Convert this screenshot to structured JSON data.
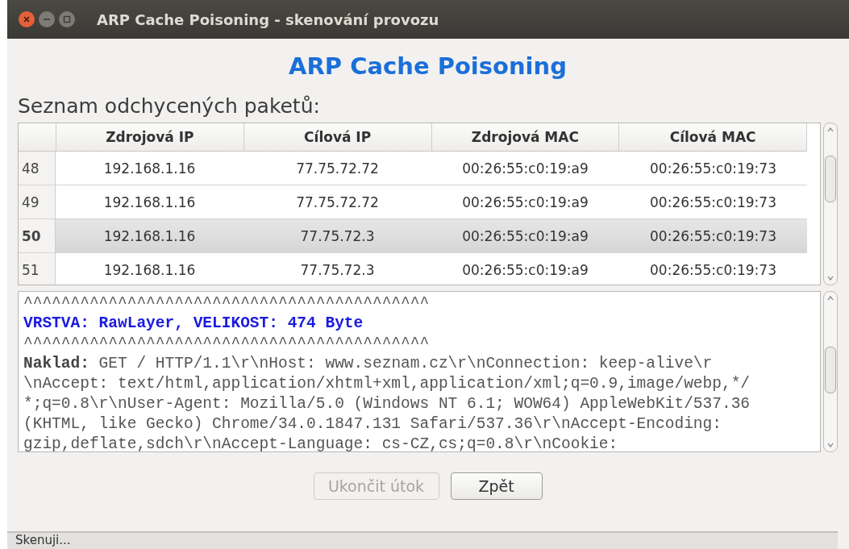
{
  "window": {
    "title": "ARP Cache Poisoning - skenování provozu"
  },
  "heading": "ARP Cache Poisoning",
  "list_label": "Seznam odchycených paketů:",
  "table": {
    "columns": [
      "Zdrojová IP",
      "Cílová IP",
      "Zdrojová MAC",
      "Cílová MAC"
    ],
    "rows": [
      {
        "index": "48",
        "cells": [
          "192.168.1.16",
          "77.75.72.72",
          "00:26:55:c0:19:a9",
          "00:26:55:c0:19:73"
        ],
        "selected": false
      },
      {
        "index": "49",
        "cells": [
          "192.168.1.16",
          "77.75.72.72",
          "00:26:55:c0:19:a9",
          "00:26:55:c0:19:73"
        ],
        "selected": false
      },
      {
        "index": "50",
        "cells": [
          "192.168.1.16",
          "77.75.72.3",
          "00:26:55:c0:19:a9",
          "00:26:55:c0:19:73"
        ],
        "selected": true
      },
      {
        "index": "51",
        "cells": [
          "192.168.1.16",
          "77.75.72.3",
          "00:26:55:c0:19:a9",
          "00:26:55:c0:19:73"
        ],
        "selected": false
      }
    ]
  },
  "detail": {
    "lines": [
      {
        "kind": "rule",
        "text": "^^^^^^^^^^^^^^^^^^^^^^^^^^^^^^^^^^^^^^^^^^^"
      },
      {
        "kind": "layer",
        "text": "VRSTVA: RawLayer, VELIKOST: 474 Byte"
      },
      {
        "kind": "rule",
        "text": "^^^^^^^^^^^^^^^^^^^^^^^^^^^^^^^^^^^^^^^^^^^"
      },
      {
        "kind": "payload",
        "text": "**Naklad:** GET / HTTP/1.1\\r\\nHost: www.seznam.cz\\r\\nConnection: keep-alive\\r"
      },
      {
        "kind": "payload",
        "text": "\\nAccept: text/html,application/xhtml+xml,application/xml;q=0.9,image/webp,*/"
      },
      {
        "kind": "payload",
        "text": "*;q=0.8\\r\\nUser-Agent: Mozilla/5.0 (Windows NT 6.1; WOW64) AppleWebKit/537.36"
      },
      {
        "kind": "payload",
        "text": "(KHTML, like Gecko) Chrome/34.0.1847.131 Safari/537.36\\r\\nAccept-Encoding:"
      },
      {
        "kind": "payload",
        "text": "gzip,deflate,sdch\\r\\nAccept-Language: cs-CZ,cs;q=0.8\\r\\nCookie:"
      }
    ]
  },
  "buttons": [
    {
      "label": "Ukončit útok",
      "disabled": true
    },
    {
      "label": "Zpět",
      "disabled": false
    }
  ],
  "status_log": "Skenuji..."
}
